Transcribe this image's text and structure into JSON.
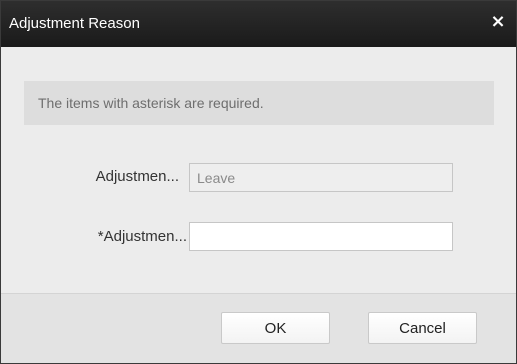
{
  "dialog": {
    "title": "Adjustment Reason",
    "close_icon": "close-icon",
    "close_glyph": "×"
  },
  "notice": {
    "text": "The items with asterisk are required."
  },
  "form": {
    "type_label": "Adjustmen...",
    "type_value": "Leave",
    "reason_label": "*Adjustmen...",
    "reason_value": ""
  },
  "footer": {
    "ok_label": "OK",
    "cancel_label": "Cancel"
  },
  "colors": {
    "titlebar": "#1f1f1f",
    "body": "#ececec",
    "notice_bg": "#dddddd",
    "footer_bg": "#e3e3e3"
  }
}
